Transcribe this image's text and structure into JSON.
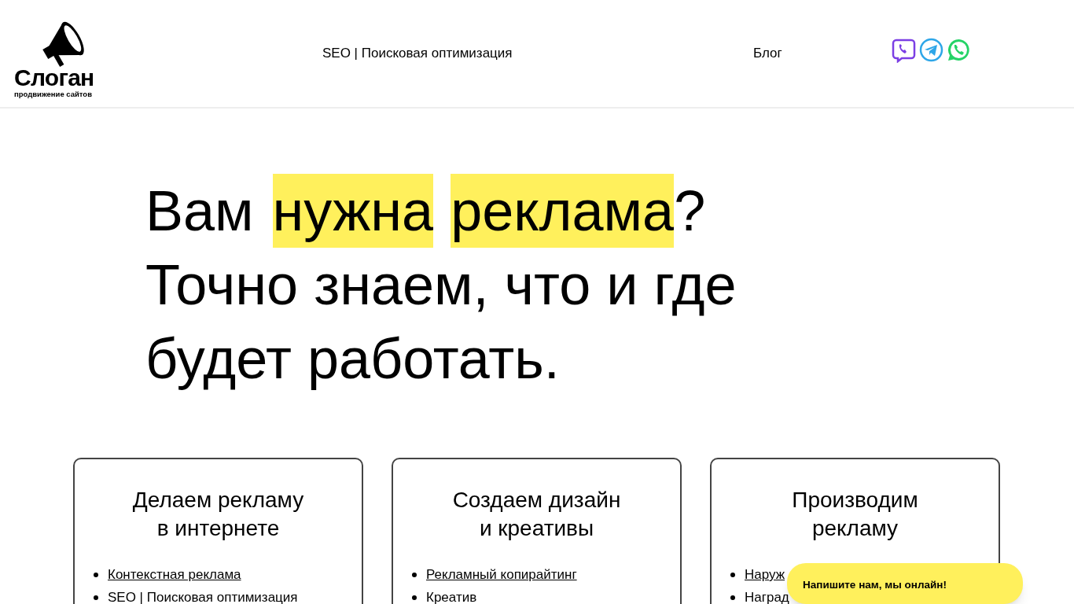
{
  "logo": {
    "title": "Слоган",
    "subtitle": "продвижение сайтов"
  },
  "nav": [
    "SEO | Поисковая оптимизация",
    "Блог"
  ],
  "hero": {
    "lines": [
      [
        {
          "text": "Вам",
          "highlighted": false
        },
        {
          "text": "нужна",
          "highlighted": true
        },
        {
          "text": "реклама",
          "highlighted": true
        },
        {
          "text": "?",
          "highlighted": false
        }
      ],
      [
        {
          "text": "Точно знаем, что и где",
          "highlighted": false
        }
      ],
      [
        {
          "text": "будет работать.",
          "highlighted": false
        }
      ]
    ]
  },
  "cards": [
    {
      "title": [
        "Делаем рекламу",
        "в интернете"
      ],
      "items": [
        {
          "text": "Контекстная реклама",
          "link": true
        },
        {
          "text": "SEO | Поисковая оптимизация",
          "link": false
        }
      ]
    },
    {
      "title": [
        "Создаем дизайн",
        "и креативы"
      ],
      "items": [
        {
          "text": "Рекламный копирайтинг",
          "link": true
        },
        {
          "text": "Креатив",
          "link": false
        }
      ]
    },
    {
      "title": [
        "Производим",
        "рекламу"
      ],
      "items": [
        {
          "text": "Наруж",
          "link": true
        },
        {
          "text": "Наград",
          "link": false
        }
      ]
    }
  ],
  "chat_popup": {
    "text": "Напишите нам, мы онлайн!"
  }
}
